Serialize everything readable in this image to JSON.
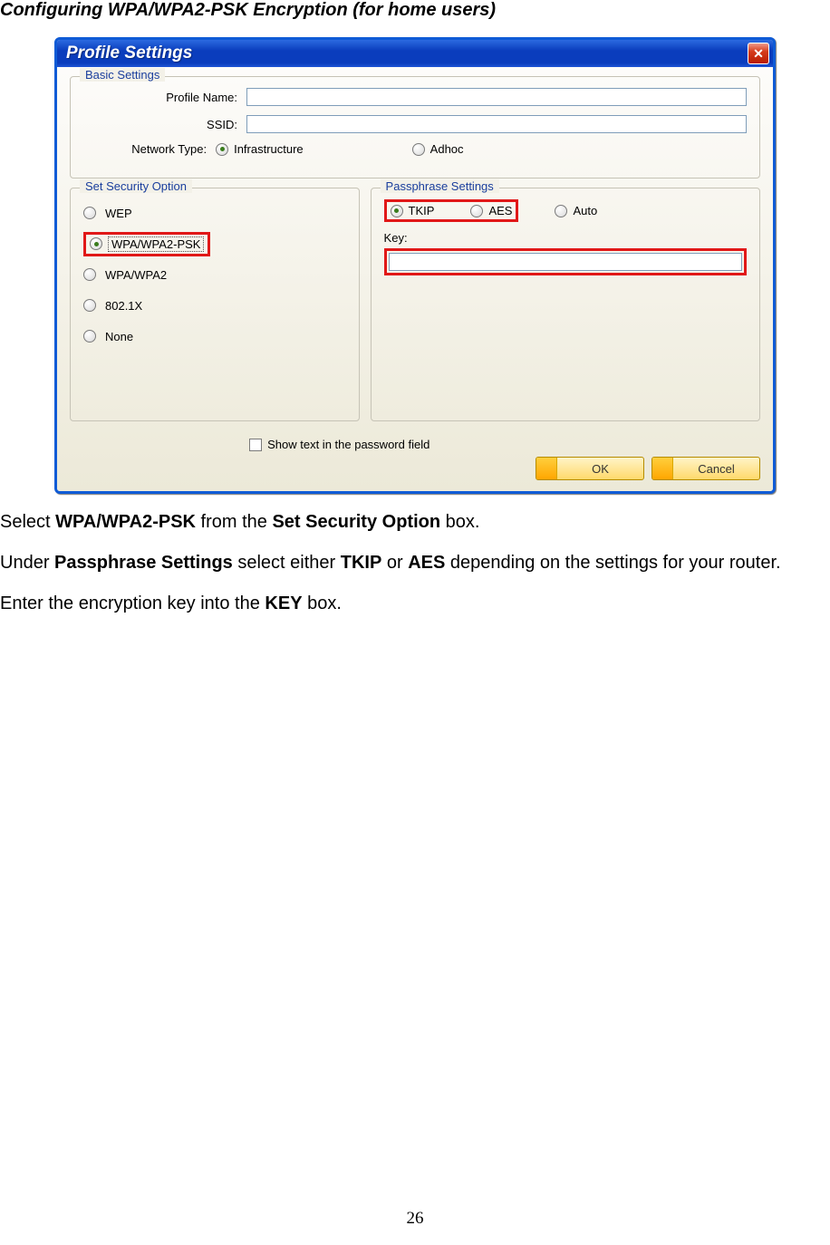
{
  "doc": {
    "heading": "Configuring WPA/WPA2-PSK Encryption (for home users)",
    "para1_parts": [
      "Select ",
      "WPA/WPA2-PSK",
      " from the ",
      "Set Security Option",
      " box."
    ],
    "para2_parts": [
      "Under ",
      "Passphrase Settings",
      " select either ",
      "TKIP",
      " or ",
      "AES",
      " depending on the settings for your router."
    ],
    "para3_parts": [
      "Enter the encryption key into the ",
      "KEY",
      " box."
    ],
    "page_number": "26"
  },
  "dialog": {
    "title": "Profile Settings",
    "close_glyph": "✕",
    "basic_settings": {
      "legend": "Basic Settings",
      "profile_name_label": "Profile Name:",
      "profile_name_value": "",
      "ssid_label": "SSID:",
      "ssid_value": "",
      "network_type_label": "Network Type:",
      "options": [
        {
          "label": "Infrastructure",
          "selected": true
        },
        {
          "label": "Adhoc",
          "selected": false
        }
      ]
    },
    "security": {
      "legend": "Set Security Option",
      "options": [
        {
          "label": "WEP",
          "selected": false
        },
        {
          "label": "WPA/WPA2-PSK",
          "selected": true
        },
        {
          "label": "WPA/WPA2",
          "selected": false
        },
        {
          "label": "802.1X",
          "selected": false
        },
        {
          "label": "None",
          "selected": false
        }
      ]
    },
    "passphrase": {
      "legend": "Passphrase Settings",
      "options": [
        {
          "label": "TKIP",
          "selected": true
        },
        {
          "label": "AES",
          "selected": false
        },
        {
          "label": "Auto",
          "selected": false
        }
      ],
      "key_label": "Key:",
      "key_value": "",
      "show_text_label": "Show text in the password field",
      "show_text_checked": false
    },
    "buttons": {
      "ok": "OK",
      "cancel": "Cancel"
    }
  }
}
